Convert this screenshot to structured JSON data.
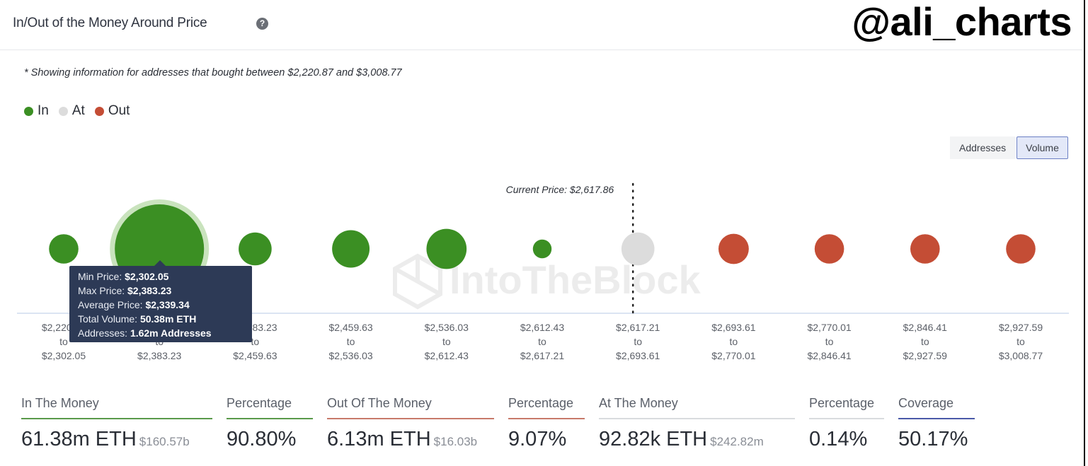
{
  "header": {
    "title": "In/Out of the Money Around Price",
    "help_icon": "question-circle-icon",
    "help_glyph": "?",
    "brand": "@ali_charts"
  },
  "note": "* Showing information for addresses that bought between $2,220.87 and $3,008.77",
  "legend": [
    {
      "label": "In",
      "color": "#3b8f23"
    },
    {
      "label": "At",
      "color": "#dcdcdc"
    },
    {
      "label": "Out",
      "color": "#c44d35"
    }
  ],
  "toggle": {
    "addresses_label": "Addresses",
    "volume_label": "Volume",
    "active": "Volume"
  },
  "watermark": "IntoTheBlock",
  "tooltip": {
    "min_label": "Min Price: ",
    "min_value": "$2,302.05",
    "max_label": "Max Price: ",
    "max_value": "$2,383.23",
    "avg_label": "Average Price: ",
    "avg_value": "$2,339.34",
    "vol_label": "Total Volume: ",
    "vol_value": "50.38m ETH",
    "addr_label": "Addresses: ",
    "addr_value": "1.62m Addresses"
  },
  "chart_data": {
    "type": "scatter",
    "subtype": "bubble",
    "title": "In/Out of the Money Around Price",
    "metric": "Volume",
    "current_price_label": "Current Price: $2,617.86",
    "current_price": 2617.86,
    "current_price_bin_index": 6,
    "bins": [
      {
        "from": "$2,220.87",
        "to": "$2,302.05",
        "status": "In",
        "relative_size": 0.33
      },
      {
        "from": "$2,302.05",
        "to": "$2,383.23",
        "status": "In",
        "relative_size": 1.0,
        "volume": "50.38m ETH",
        "addresses": "1.62m Addresses",
        "avg_price": "$2,339.34",
        "highlighted": true
      },
      {
        "from": "$2,383.23",
        "to": "$2,459.63",
        "status": "In",
        "relative_size": 0.37
      },
      {
        "from": "$2,459.63",
        "to": "$2,536.03",
        "status": "In",
        "relative_size": 0.42
      },
      {
        "from": "$2,536.03",
        "to": "$2,612.43",
        "status": "In",
        "relative_size": 0.45
      },
      {
        "from": "$2,612.43",
        "to": "$2,617.21",
        "status": "In",
        "relative_size": 0.21
      },
      {
        "from": "$2,617.21",
        "to": "$2,693.61",
        "status": "At",
        "relative_size": 0.37
      },
      {
        "from": "$2,693.61",
        "to": "$2,770.01",
        "status": "Out",
        "relative_size": 0.34
      },
      {
        "from": "$2,770.01",
        "to": "$2,846.41",
        "status": "Out",
        "relative_size": 0.33
      },
      {
        "from": "$2,846.41",
        "to": "$2,927.59",
        "status": "Out",
        "relative_size": 0.33
      },
      {
        "from": "$2,927.59",
        "to": "$3,008.77",
        "status": "Out",
        "relative_size": 0.33
      }
    ],
    "to_word": "to",
    "colors": {
      "In": "#3b8f23",
      "At": "#dcdcdc",
      "Out": "#c44d35",
      "highlight_halo": "#c9e3bd"
    }
  },
  "stats": [
    {
      "label": "In The Money",
      "value": "61.38m ETH",
      "sub": "$160.57b",
      "accent": "#5a9a4a"
    },
    {
      "label": "Percentage",
      "value": "90.80%",
      "sub": "",
      "accent": "#5a9a4a"
    },
    {
      "label": "Out Of The Money",
      "value": "6.13m ETH",
      "sub": "$16.03b",
      "accent": "#c77a6a"
    },
    {
      "label": "Percentage",
      "value": "9.07%",
      "sub": "",
      "accent": "#c77a6a"
    },
    {
      "label": "At The Money",
      "value": "92.82k ETH",
      "sub": "$242.82m",
      "accent": "#d9dbde"
    },
    {
      "label": "Percentage",
      "value": "0.14%",
      "sub": "",
      "accent": "#d9dbde"
    },
    {
      "label": "Coverage",
      "value": "50.17%",
      "sub": "",
      "accent": "#4a5aa8"
    }
  ]
}
